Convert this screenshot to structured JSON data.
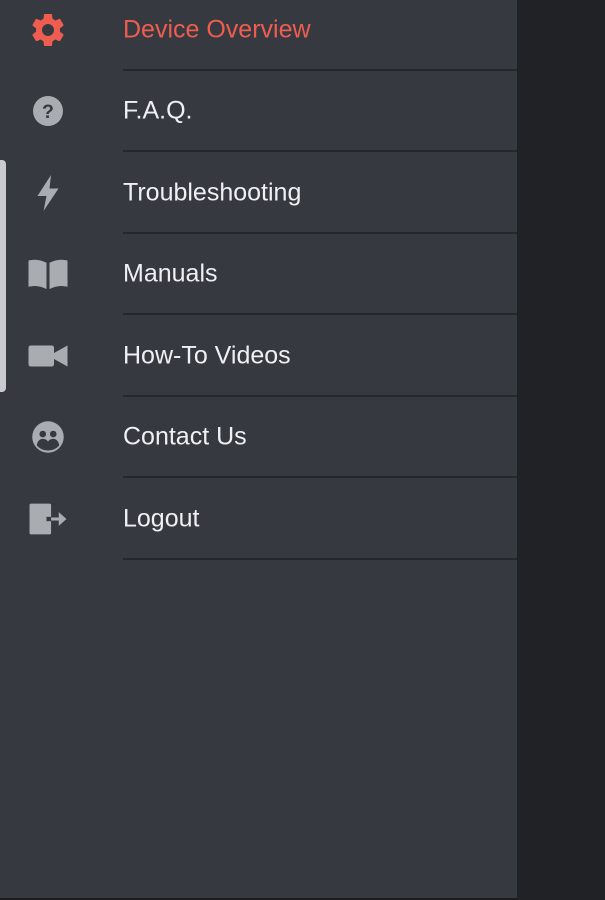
{
  "colors": {
    "drawer_bg": "#363a40",
    "scrim_bg": "#202226",
    "accent": "#ee5d4f",
    "icon_gray": "#a9acb1",
    "text": "#eef0f2"
  },
  "menu": {
    "items": [
      {
        "label": "Device Overview",
        "icon": "gear-icon",
        "active": true
      },
      {
        "label": "F.A.Q.",
        "icon": "help-circle-icon",
        "active": false
      },
      {
        "label": "Troubleshooting",
        "icon": "lightning-bolt-icon",
        "active": false
      },
      {
        "label": "Manuals",
        "icon": "open-book-icon",
        "active": false
      },
      {
        "label": "How-To Videos",
        "icon": "video-camera-icon",
        "active": false
      },
      {
        "label": "Contact Us",
        "icon": "support-group-icon",
        "active": false
      },
      {
        "label": "Logout",
        "icon": "logout-icon",
        "active": false
      }
    ]
  }
}
